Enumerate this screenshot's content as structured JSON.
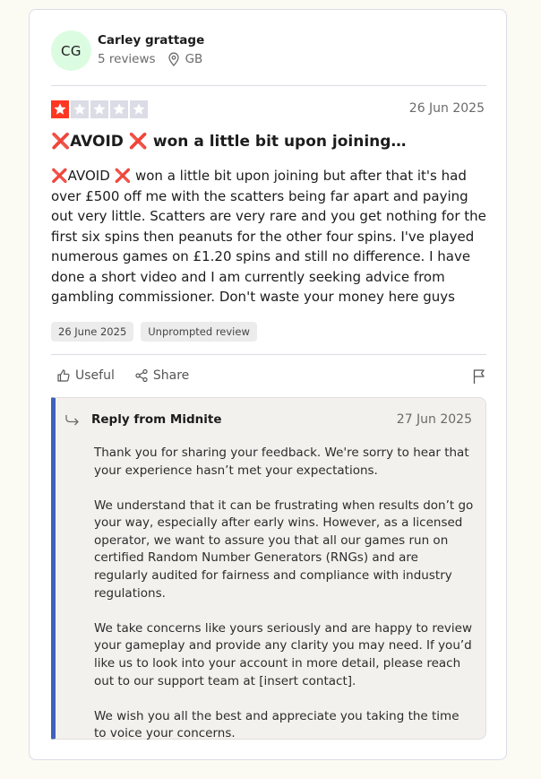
{
  "reviewer": {
    "initials": "CG",
    "name": "Carley grattage",
    "reviews_count": "5 reviews",
    "country": "GB"
  },
  "review": {
    "rating": 1,
    "rating_max": 5,
    "star_color": "#ff3722",
    "date": "26 Jun 2025",
    "title": "❌AVOID ❌ won a little bit upon joining…",
    "body": "❌AVOID ❌ won a little bit upon joining but after that it's had over £500 off me with the scatters being far apart and paying out very little. Scatters are very rare and you get nothing for the first six spins then peanuts for the other four spins. I've played numerous games on £1.20 spins and still no difference. I have done a short video and I am currently seeking advice from gambling commissioner. Don't waste your money here guys",
    "experience_date": "26 June 2025",
    "tag": "Unprompted review"
  },
  "actions": {
    "useful": "Useful",
    "share": "Share"
  },
  "reply": {
    "from": "Reply from Midnite",
    "date": "27 Jun 2025",
    "paragraphs": [
      "Thank you for sharing your feedback. We're sorry to hear that your experience hasn’t met your expectations.",
      "We understand that it can be frustrating when results don’t go your way, especially after early wins. However, as a licensed operator, we want to assure you that all our games run on certified Random Number Generators (RNGs) and are regularly audited for fairness and compliance with industry regulations.",
      "We take concerns like yours seriously and are happy to review your gameplay and provide any clarity you may need. If you’d like us to look into your account in more detail, please reach out to our support team at [insert contact].",
      "We wish you all the best and appreciate you taking the time to voice your concerns."
    ],
    "accent_color": "#4060bd"
  }
}
